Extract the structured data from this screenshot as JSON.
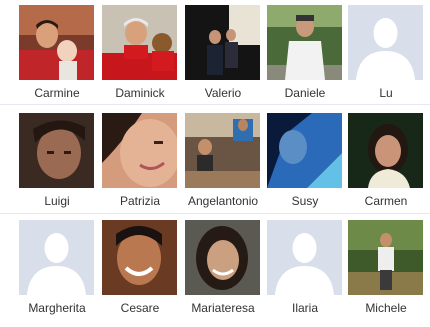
{
  "friends": [
    {
      "name": "Carmine",
      "photo": "photo"
    },
    {
      "name": "Daminick",
      "photo": "photo"
    },
    {
      "name": "Valerio",
      "photo": "photo"
    },
    {
      "name": "Daniele",
      "photo": "photo"
    },
    {
      "name": "Lu",
      "photo": "silhouette"
    },
    {
      "name": "Luigi",
      "photo": "photo"
    },
    {
      "name": "Patrizia",
      "photo": "photo"
    },
    {
      "name": "Angelantonio",
      "photo": "photo"
    },
    {
      "name": "Susy",
      "photo": "photo"
    },
    {
      "name": "Carmen",
      "photo": "photo"
    },
    {
      "name": "Margherita",
      "photo": "silhouette"
    },
    {
      "name": "Cesare",
      "photo": "photo"
    },
    {
      "name": "Mariateresa",
      "photo": "photo"
    },
    {
      "name": "Ilaria",
      "photo": "silhouette"
    },
    {
      "name": "Michele",
      "photo": "photo"
    }
  ],
  "colors": {
    "silhouette_bg": "#d8dfea",
    "silhouette_fg": "#ffffff",
    "divider": "#e5e8ef",
    "name_text": "#333333"
  }
}
